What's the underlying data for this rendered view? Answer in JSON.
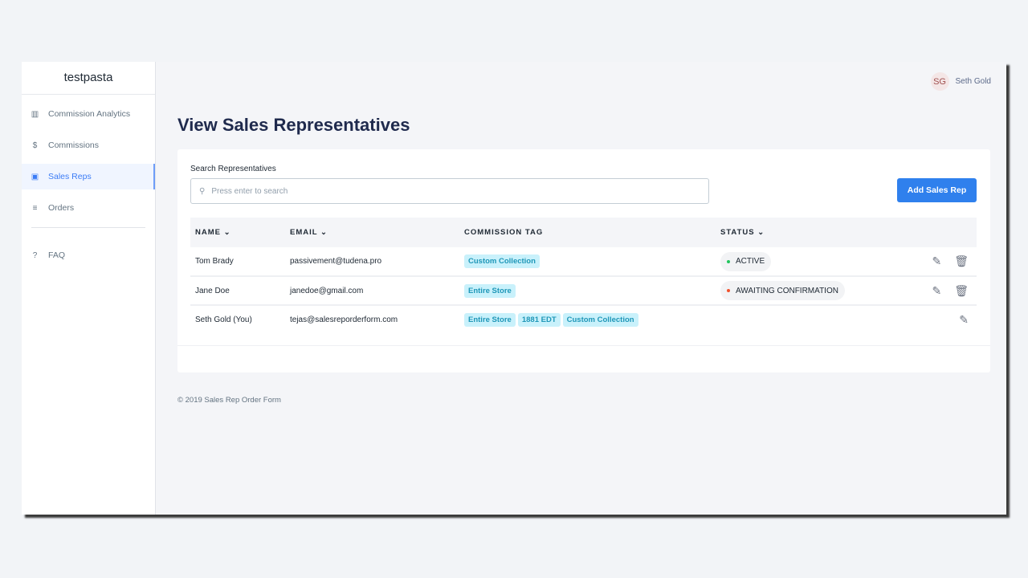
{
  "app": {
    "name": "testpasta"
  },
  "sidebar": {
    "items": [
      {
        "label": "Commission Analytics",
        "icon": "bar-chart-icon"
      },
      {
        "label": "Commissions",
        "icon": "dollar-icon"
      },
      {
        "label": "Sales Reps",
        "icon": "contact-card-icon",
        "active": true
      },
      {
        "label": "Orders",
        "icon": "list-check-icon"
      },
      {
        "label": "FAQ",
        "icon": "help-icon"
      }
    ]
  },
  "user": {
    "initials": "SG",
    "name": "Seth Gold"
  },
  "page": {
    "title": "View Sales Representatives"
  },
  "search": {
    "label": "Search Representatives",
    "placeholder": "Press enter to search"
  },
  "add_button": "Add Sales Rep",
  "table": {
    "headers": [
      "NAME",
      "EMAIL",
      "COMMISSION TAG",
      "STATUS"
    ],
    "rows": [
      {
        "name": "Tom Brady",
        "email": "passivement@tudena.pro",
        "tags": [
          "Custom Collection"
        ],
        "status": "ACTIVE",
        "status_color": "#22c55e"
      },
      {
        "name": "Jane Doe",
        "email": "janedoe@gmail.com",
        "tags": [
          "Entire Store"
        ],
        "status": "AWAITING CONFIRMATION",
        "status_color": "#f0522d"
      },
      {
        "name": "Seth Gold (You)",
        "email": "tejas@salesreporderform.com",
        "tags": [
          "Entire Store",
          "1881 EDT",
          "Custom Collection"
        ]
      }
    ]
  },
  "footer": "© 2019 Sales Rep Order Form"
}
